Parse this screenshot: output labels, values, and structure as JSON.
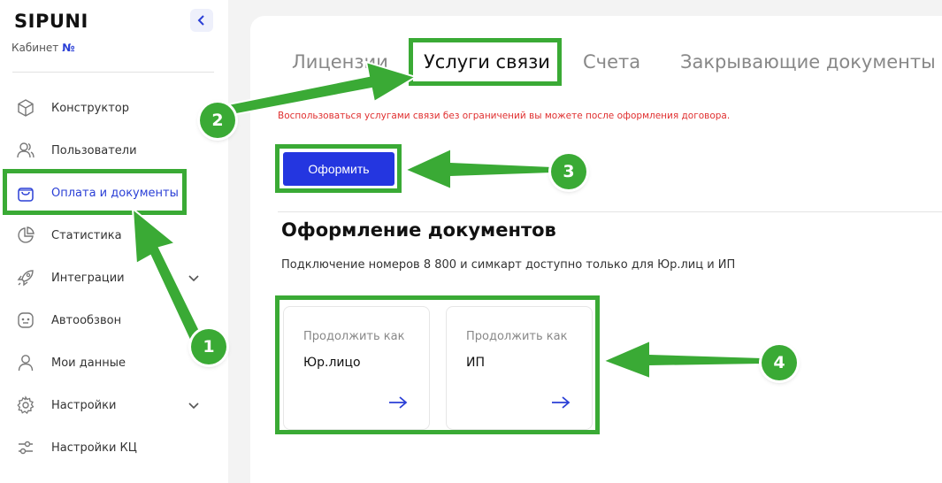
{
  "sidebar": {
    "logo": "SIPUNI",
    "cabinet_label": "Кабинет",
    "cabinet_number": "№",
    "items": [
      {
        "label": "Конструктор",
        "icon": "cube-icon"
      },
      {
        "label": "Пользователи",
        "icon": "users-icon"
      },
      {
        "label": "Оплата и документы",
        "icon": "bag-icon",
        "active": true
      },
      {
        "label": "Статистика",
        "icon": "pie-chart-icon"
      },
      {
        "label": "Интеграции",
        "icon": "rocket-icon",
        "expandable": true
      },
      {
        "label": "Автообзвон",
        "icon": "robot-icon"
      },
      {
        "label": "Мои данные",
        "icon": "user-icon"
      },
      {
        "label": "Настройки",
        "icon": "gear-icon",
        "expandable": true
      },
      {
        "label": "Настройки КЦ",
        "icon": "sliders-icon"
      }
    ]
  },
  "tabs": [
    {
      "label": "Лицензии"
    },
    {
      "label": "Услуги связи",
      "active": true
    },
    {
      "label": "Счета"
    },
    {
      "label": "Закрывающие документы"
    }
  ],
  "notice": "Воспользоваться услугами связи без ограничений вы можете после оформления договора.",
  "primary_button": "Оформить",
  "section": {
    "title": "Оформление документов",
    "subtitle": "Подключение номеров 8 800 и симкарт доступно только для Юр.лиц и ИП"
  },
  "options": [
    {
      "caption": "Продолжить как",
      "value": "Юр.лицо"
    },
    {
      "caption": "Продолжить как",
      "value": "ИП"
    }
  ],
  "annotations": {
    "badges": [
      "1",
      "2",
      "3",
      "4"
    ],
    "color": "#3aaa35"
  },
  "colors": {
    "accent": "#2436e0",
    "warning": "#e03030",
    "annotation": "#3aaa35"
  }
}
